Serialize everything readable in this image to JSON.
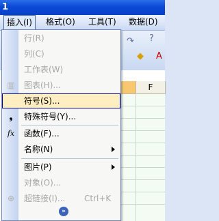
{
  "window": {
    "title": "1"
  },
  "menubar": {
    "items": [
      {
        "label": "插入(I)"
      },
      {
        "label": "格式(O)"
      },
      {
        "label": "工具(T)"
      },
      {
        "label": "数据(D)"
      }
    ]
  },
  "columns": {
    "selected": "",
    "next": "F"
  },
  "insert_menu": {
    "items": [
      {
        "label": "行(R)",
        "disabled": true
      },
      {
        "label": "列(C)",
        "disabled": true
      },
      {
        "label": "工作表(W)",
        "disabled": true
      },
      {
        "label": "图表(H)...",
        "disabled": true,
        "icon": "chart-icon"
      },
      {
        "label": "符号(S)...",
        "disabled": false,
        "hover": true
      },
      {
        "label": "特殊符号(Y)...",
        "disabled": false,
        "icon": "special-symbol-icon"
      },
      {
        "label": "函数(F)...",
        "disabled": false,
        "icon": "function-icon",
        "icon_text": "fx"
      },
      {
        "label": "名称(N)",
        "disabled": false,
        "submenu": true
      },
      {
        "label": "图片(P)",
        "disabled": false,
        "submenu": true
      },
      {
        "label": "对象(O)...",
        "disabled": true
      },
      {
        "label": "超链接(I)...",
        "disabled": true,
        "shortcut": "Ctrl+K",
        "icon": "hyperlink-icon"
      }
    ],
    "expand_icon": "»"
  },
  "colors": {
    "accent": "#0a4ad6",
    "hover": "#ffeec2",
    "selected_column": "#f7c870"
  }
}
